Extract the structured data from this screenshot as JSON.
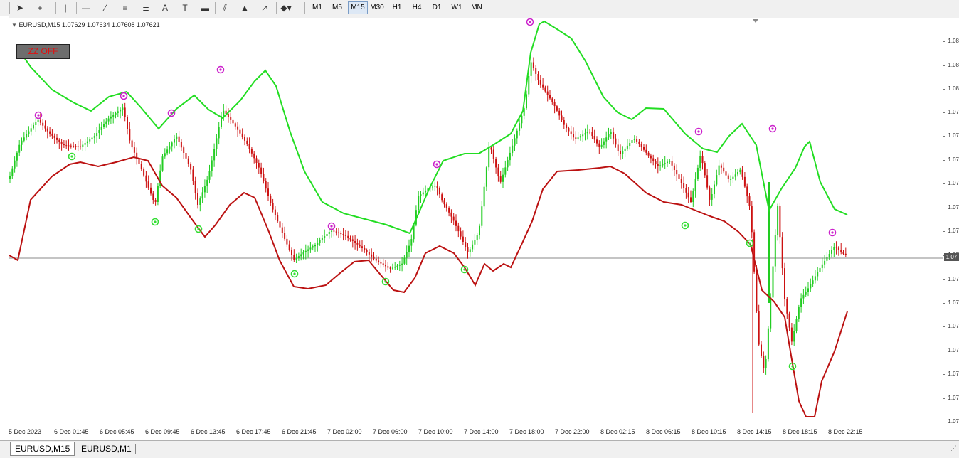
{
  "toolbar": {
    "tools": [
      {
        "name": "cursor-icon",
        "glyph": "➤"
      },
      {
        "name": "crosshair-icon",
        "glyph": "+"
      },
      {
        "name": "vertical-line-icon",
        "glyph": "|"
      },
      {
        "name": "horizontal-line-icon",
        "glyph": "—"
      },
      {
        "name": "trend-line-icon",
        "glyph": "⁄"
      },
      {
        "name": "fibonacci-fan-icon",
        "glyph": "≡"
      },
      {
        "name": "fibonacci-retracement-icon",
        "glyph": "≣"
      },
      {
        "name": "text-icon",
        "glyph": "A"
      },
      {
        "name": "text-label-icon",
        "glyph": "T"
      },
      {
        "name": "rectangle-icon",
        "glyph": "▬"
      },
      {
        "name": "channel-icon",
        "glyph": "⫽"
      },
      {
        "name": "triangle-icon",
        "glyph": "▲"
      },
      {
        "name": "arrow-draw-icon",
        "glyph": "↗"
      },
      {
        "name": "more-shapes-icon",
        "glyph": "◆▾"
      }
    ],
    "timeframes": [
      "M1",
      "M5",
      "M15",
      "M30",
      "H1",
      "H4",
      "D1",
      "W1",
      "MN"
    ],
    "active_timeframe": "M15"
  },
  "chart": {
    "info_line": "EURUSD,M15  1.07629 1.07634 1.07608 1.07621",
    "zz_button": "ZZ OFF",
    "current_price_label": "1.07",
    "price_labels": [
      "1.08",
      "1.08",
      "1.08",
      "1.07",
      "1.07",
      "1.07",
      "1.07",
      "1.07",
      "1.07",
      "1.07",
      "1.07",
      "1.07",
      "1.07",
      "1.07",
      "1.07",
      "1.07",
      "1.07"
    ],
    "time_labels": [
      "5 Dec 2023",
      "6 Dec 01:45",
      "6 Dec 05:45",
      "6 Dec 09:45",
      "6 Dec 13:45",
      "6 Dec 17:45",
      "6 Dec 21:45",
      "7 Dec 02:00",
      "7 Dec 06:00",
      "7 Dec 10:00",
      "7 Dec 14:00",
      "7 Dec 18:00",
      "7 Dec 22:00",
      "8 Dec 02:15",
      "8 Dec 06:15",
      "8 Dec 10:15",
      "8 Dec 14:15",
      "8 Dec 18:15",
      "8 Dec 22:15"
    ],
    "colors": {
      "bull": "#22cc22",
      "bear": "#cc1111",
      "upper_band": "#22dd22",
      "lower_band": "#bb1111",
      "zz_high": "#cc22cc",
      "zz_low": "#33dd33"
    }
  },
  "tabs": [
    {
      "label": "EURUSD,M15",
      "active": true
    },
    {
      "label": "EURUSD,M1",
      "active": false
    }
  ]
}
